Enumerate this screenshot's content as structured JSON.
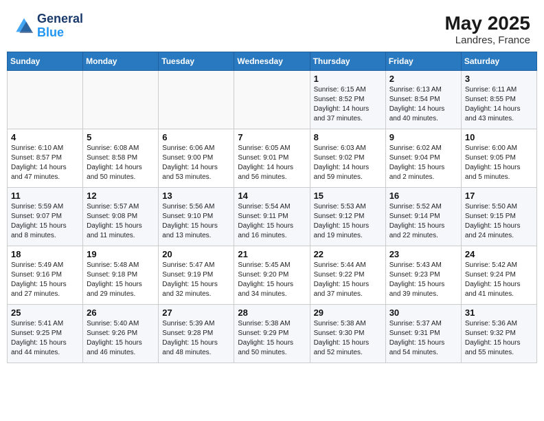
{
  "header": {
    "logo_line1": "General",
    "logo_line2": "Blue",
    "month_year": "May 2025",
    "location": "Landres, France"
  },
  "weekdays": [
    "Sunday",
    "Monday",
    "Tuesday",
    "Wednesday",
    "Thursday",
    "Friday",
    "Saturday"
  ],
  "weeks": [
    [
      {
        "day": "",
        "info": ""
      },
      {
        "day": "",
        "info": ""
      },
      {
        "day": "",
        "info": ""
      },
      {
        "day": "",
        "info": ""
      },
      {
        "day": "1",
        "info": "Sunrise: 6:15 AM\nSunset: 8:52 PM\nDaylight: 14 hours\nand 37 minutes."
      },
      {
        "day": "2",
        "info": "Sunrise: 6:13 AM\nSunset: 8:54 PM\nDaylight: 14 hours\nand 40 minutes."
      },
      {
        "day": "3",
        "info": "Sunrise: 6:11 AM\nSunset: 8:55 PM\nDaylight: 14 hours\nand 43 minutes."
      }
    ],
    [
      {
        "day": "4",
        "info": "Sunrise: 6:10 AM\nSunset: 8:57 PM\nDaylight: 14 hours\nand 47 minutes."
      },
      {
        "day": "5",
        "info": "Sunrise: 6:08 AM\nSunset: 8:58 PM\nDaylight: 14 hours\nand 50 minutes."
      },
      {
        "day": "6",
        "info": "Sunrise: 6:06 AM\nSunset: 9:00 PM\nDaylight: 14 hours\nand 53 minutes."
      },
      {
        "day": "7",
        "info": "Sunrise: 6:05 AM\nSunset: 9:01 PM\nDaylight: 14 hours\nand 56 minutes."
      },
      {
        "day": "8",
        "info": "Sunrise: 6:03 AM\nSunset: 9:02 PM\nDaylight: 14 hours\nand 59 minutes."
      },
      {
        "day": "9",
        "info": "Sunrise: 6:02 AM\nSunset: 9:04 PM\nDaylight: 15 hours\nand 2 minutes."
      },
      {
        "day": "10",
        "info": "Sunrise: 6:00 AM\nSunset: 9:05 PM\nDaylight: 15 hours\nand 5 minutes."
      }
    ],
    [
      {
        "day": "11",
        "info": "Sunrise: 5:59 AM\nSunset: 9:07 PM\nDaylight: 15 hours\nand 8 minutes."
      },
      {
        "day": "12",
        "info": "Sunrise: 5:57 AM\nSunset: 9:08 PM\nDaylight: 15 hours\nand 11 minutes."
      },
      {
        "day": "13",
        "info": "Sunrise: 5:56 AM\nSunset: 9:10 PM\nDaylight: 15 hours\nand 13 minutes."
      },
      {
        "day": "14",
        "info": "Sunrise: 5:54 AM\nSunset: 9:11 PM\nDaylight: 15 hours\nand 16 minutes."
      },
      {
        "day": "15",
        "info": "Sunrise: 5:53 AM\nSunset: 9:12 PM\nDaylight: 15 hours\nand 19 minutes."
      },
      {
        "day": "16",
        "info": "Sunrise: 5:52 AM\nSunset: 9:14 PM\nDaylight: 15 hours\nand 22 minutes."
      },
      {
        "day": "17",
        "info": "Sunrise: 5:50 AM\nSunset: 9:15 PM\nDaylight: 15 hours\nand 24 minutes."
      }
    ],
    [
      {
        "day": "18",
        "info": "Sunrise: 5:49 AM\nSunset: 9:16 PM\nDaylight: 15 hours\nand 27 minutes."
      },
      {
        "day": "19",
        "info": "Sunrise: 5:48 AM\nSunset: 9:18 PM\nDaylight: 15 hours\nand 29 minutes."
      },
      {
        "day": "20",
        "info": "Sunrise: 5:47 AM\nSunset: 9:19 PM\nDaylight: 15 hours\nand 32 minutes."
      },
      {
        "day": "21",
        "info": "Sunrise: 5:45 AM\nSunset: 9:20 PM\nDaylight: 15 hours\nand 34 minutes."
      },
      {
        "day": "22",
        "info": "Sunrise: 5:44 AM\nSunset: 9:22 PM\nDaylight: 15 hours\nand 37 minutes."
      },
      {
        "day": "23",
        "info": "Sunrise: 5:43 AM\nSunset: 9:23 PM\nDaylight: 15 hours\nand 39 minutes."
      },
      {
        "day": "24",
        "info": "Sunrise: 5:42 AM\nSunset: 9:24 PM\nDaylight: 15 hours\nand 41 minutes."
      }
    ],
    [
      {
        "day": "25",
        "info": "Sunrise: 5:41 AM\nSunset: 9:25 PM\nDaylight: 15 hours\nand 44 minutes."
      },
      {
        "day": "26",
        "info": "Sunrise: 5:40 AM\nSunset: 9:26 PM\nDaylight: 15 hours\nand 46 minutes."
      },
      {
        "day": "27",
        "info": "Sunrise: 5:39 AM\nSunset: 9:28 PM\nDaylight: 15 hours\nand 48 minutes."
      },
      {
        "day": "28",
        "info": "Sunrise: 5:38 AM\nSunset: 9:29 PM\nDaylight: 15 hours\nand 50 minutes."
      },
      {
        "day": "29",
        "info": "Sunrise: 5:38 AM\nSunset: 9:30 PM\nDaylight: 15 hours\nand 52 minutes."
      },
      {
        "day": "30",
        "info": "Sunrise: 5:37 AM\nSunset: 9:31 PM\nDaylight: 15 hours\nand 54 minutes."
      },
      {
        "day": "31",
        "info": "Sunrise: 5:36 AM\nSunset: 9:32 PM\nDaylight: 15 hours\nand 55 minutes."
      }
    ]
  ]
}
